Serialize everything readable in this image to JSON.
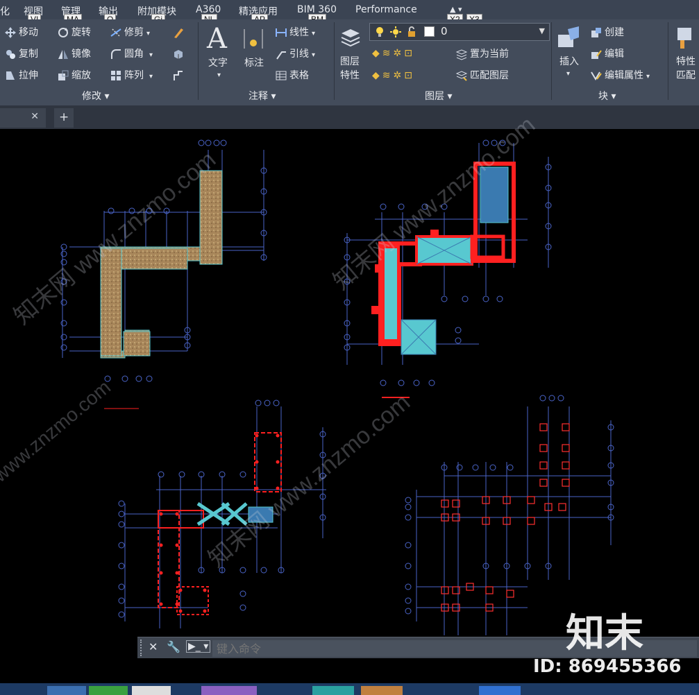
{
  "menu": [
    "化",
    "视图",
    "管理",
    "输出",
    "附加模块",
    "A360",
    "精选应用",
    "BIM 360",
    "Performance"
  ],
  "keytips": [
    "VI",
    "MA",
    "O",
    "Gi",
    "NL",
    "AP",
    "BM",
    "X2",
    "X3"
  ],
  "modify": {
    "move": "移动",
    "rotate": "旋转",
    "trim": "修剪",
    "copy": "复制",
    "mirror": "镜像",
    "fillet": "圆角",
    "stretch": "拉伸",
    "scale": "缩放",
    "array": "阵列",
    "title": "修改"
  },
  "annotation": {
    "text": "文字",
    "dimension": "标注",
    "linear": "线性",
    "leader": "引线",
    "table": "表格",
    "title": "注释"
  },
  "layers": {
    "layer_props_1": "图层",
    "layer_props_2": "特性",
    "current_layer": "0",
    "make_current": "置为当前",
    "match_layer": "匹配图层",
    "title": "图层"
  },
  "block": {
    "insert": "插入",
    "create": "创建",
    "edit": "编辑",
    "edit_attributes": "编辑属性",
    "title": "块"
  },
  "properties": {
    "label_1": "特性",
    "label_2": "匹配"
  },
  "command": {
    "placeholder": "键入命令"
  },
  "watermark": {
    "logo": "知末",
    "id": "ID: 869455366",
    "site": "www.znzmo.com",
    "mark": "知末网"
  },
  "colors": {
    "menubar": "#3b4453",
    "ribbon": "#434c5b",
    "canvas": "#000000",
    "grid": "#4a64c8",
    "red": "#ff2020",
    "cyan": "#58c8d0"
  }
}
